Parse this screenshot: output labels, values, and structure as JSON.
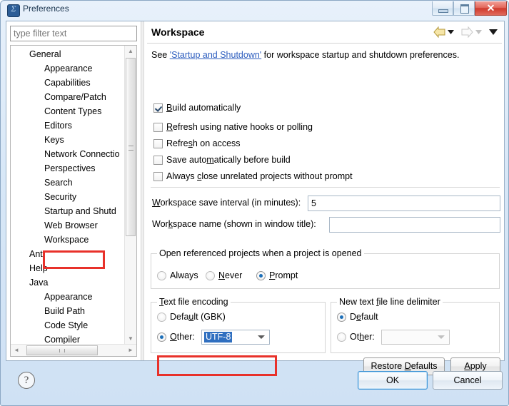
{
  "window": {
    "title": "Preferences",
    "icon": "eclipse-icon",
    "minimize_label": "",
    "maximize_label": "",
    "close_label": "✕"
  },
  "sidebar": {
    "filter": {
      "value": "",
      "placeholder": "type filter text"
    },
    "items": [
      {
        "label": "General",
        "level": 1
      },
      {
        "label": "Appearance",
        "level": 2
      },
      {
        "label": "Capabilities",
        "level": 2
      },
      {
        "label": "Compare/Patch",
        "level": 2
      },
      {
        "label": "Content Types",
        "level": 2
      },
      {
        "label": "Editors",
        "level": 2
      },
      {
        "label": "Keys",
        "level": 2
      },
      {
        "label": "Network Connectio",
        "level": 2
      },
      {
        "label": "Perspectives",
        "level": 2
      },
      {
        "label": "Search",
        "level": 2
      },
      {
        "label": "Security",
        "level": 2
      },
      {
        "label": "Startup and Shutd",
        "level": 2
      },
      {
        "label": "Web Browser",
        "level": 2
      },
      {
        "label": "Workspace",
        "level": 2
      },
      {
        "label": "Ant",
        "level": 1
      },
      {
        "label": "Help",
        "level": 1
      },
      {
        "label": "Java",
        "level": 1
      },
      {
        "label": "Appearance",
        "level": 2
      },
      {
        "label": "Build Path",
        "level": 2
      },
      {
        "label": "Code Style",
        "level": 2
      },
      {
        "label": "Compiler",
        "level": 2
      }
    ],
    "selected": "Workspace",
    "highlight_color": "#e8312a",
    "scroll_up": "▲",
    "scroll_down": "▼",
    "scroll_left": "◄",
    "scroll_right": "►"
  },
  "page": {
    "title": "Workspace",
    "nav": {
      "back": "back-arrow",
      "back_menu": "▼",
      "forward": "forward-arrow",
      "forward_menu": "▼",
      "view_menu": "▼"
    },
    "intro": {
      "prefix": "See ",
      "link": "'Startup and Shutdown'",
      "suffix": " for workspace startup and shutdown preferences."
    },
    "checkboxes": [
      {
        "label": "Build automatically",
        "mnemonic": "B",
        "checked": true
      },
      {
        "label": "Refresh using native hooks or polling",
        "mnemonic": "R",
        "checked": false
      },
      {
        "label": "Refresh on access",
        "mnemonic": "s",
        "checked": false
      },
      {
        "label": "Save automatically before build",
        "mnemonic": "m",
        "checked": false
      },
      {
        "label": "Always close unrelated projects without prompt",
        "mnemonic": "c",
        "checked": false
      }
    ],
    "fields": [
      {
        "label": "Workspace save interval (in minutes):",
        "value": "5"
      },
      {
        "label": "Workspace name (shown in window title):",
        "value": ""
      }
    ],
    "open_referenced": {
      "title": "Open referenced projects when a project is opened",
      "options": [
        {
          "label": "Always",
          "selected": false
        },
        {
          "label": "Never",
          "selected": false
        },
        {
          "label": "Prompt",
          "selected": true
        }
      ]
    },
    "text_file_encoding": {
      "title": "Text file encoding",
      "default_label": "Default (GBK)",
      "default_selected": false,
      "other_label": "Other:",
      "other_selected": true,
      "other_value": "UTF-8",
      "highlight_color": "#e8312a"
    },
    "line_delimiter": {
      "title": "New text file line delimiter",
      "default_label": "Default",
      "default_selected": true,
      "other_label": "Other:",
      "other_selected": false,
      "other_value": ""
    },
    "buttons": {
      "restore_defaults": "Restore Defaults",
      "apply": "Apply"
    }
  },
  "footer": {
    "help": "?",
    "ok": "OK",
    "cancel": "Cancel"
  }
}
